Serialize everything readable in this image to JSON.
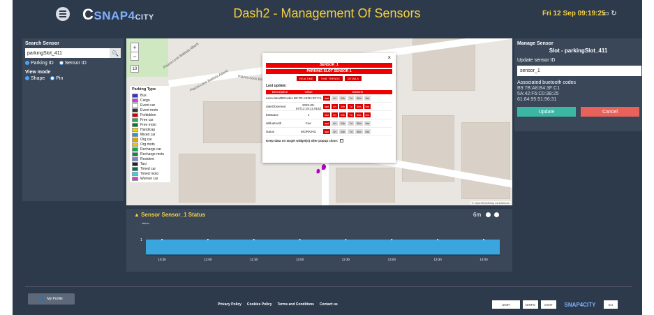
{
  "header": {
    "title": "Dash2 - Management Of Sensors",
    "datetime": "Fri 12 Sep 09:19:25",
    "logo": {
      "part1": "SNAP",
      "part2": "4",
      "part3": "CITY"
    }
  },
  "search_panel": {
    "title": "Search Sensor",
    "search_value": "parkingSlot_411",
    "options": [
      "Parking ID",
      "Sensor ID"
    ],
    "view_mode_label": "View mode",
    "view_options": [
      "Shape",
      "Pin"
    ]
  },
  "map": {
    "zoom_in": "+",
    "zoom_out": "−",
    "zoom_level": "19",
    "labels": [
      "Piazza Leon Battista Alberti",
      "Piazza Leon Battista Alberti",
      "Piazza Leon Ba"
    ],
    "attribution": "© OpenStreetMap contributors",
    "legend": {
      "title": "Parking Type",
      "items": [
        {
          "label": "Bus",
          "color": "#3a2ed6"
        },
        {
          "label": "Cargo",
          "color": "#d43ad6"
        },
        {
          "label": "Event car",
          "color": "#ffffff"
        },
        {
          "label": "Event moto",
          "color": "#333333"
        },
        {
          "label": "Forbidden",
          "color": "#cc0000"
        },
        {
          "label": "Free car",
          "color": "#1fb24a"
        },
        {
          "label": "Free moto",
          "color": "#0a7a2a"
        },
        {
          "label": "Handicap",
          "color": "#f2d200"
        },
        {
          "label": "Mixed car",
          "color": "#1f9ad6"
        },
        {
          "label": "Org car",
          "color": "#e0a800"
        },
        {
          "label": "Org moto",
          "color": "#f2c200"
        },
        {
          "label": "Recharge car",
          "color": "#13a84a"
        },
        {
          "label": "Recharge moto",
          "color": "#0d8a3a"
        },
        {
          "label": "Resident",
          "color": "#7f7fd6"
        },
        {
          "label": "Taxi",
          "color": "#222222"
        },
        {
          "label": "Timed car",
          "color": "#0d6b5c"
        },
        {
          "label": "Timed moto",
          "color": "#35d6e0"
        },
        {
          "label": "Women car",
          "color": "#d63ad6"
        }
      ]
    }
  },
  "popup": {
    "close": "×",
    "title1": "SENSOR_1",
    "title2": "PARKING SLOT SENSOR 1",
    "buttons": [
      "REALTIME",
      "TIME TRENDS",
      "DETAILS"
    ],
    "last_update": "Last update:",
    "columns": [
      "Description",
      "Value",
      "Buttons"
    ],
    "rows": [
      {
        "name": "associatedBtCodes",
        "value": "B9:7B:A8:B4:3F:C1,...",
        "buttons": [
          "last",
          "4h",
          "24h",
          "7d",
          "30d",
          "6m"
        ]
      },
      {
        "name": "dateObserved",
        "value": "2025-09-04T12:15:11.916Z",
        "buttons": [
          "last",
          "4h",
          "24h",
          "7d",
          "30d",
          "6m"
        ]
      },
      {
        "name": "bttStatus",
        "value": "1",
        "buttons": [
          "last",
          "4h",
          "24h",
          "7d",
          "30d",
          "6m"
        ]
      },
      {
        "name": "isBluetooth",
        "value": "true",
        "buttons": [
          "last",
          "4h",
          "24h",
          "7d",
          "30d",
          "6m"
        ]
      },
      {
        "name": "status",
        "value": "WORKING",
        "buttons": [
          "last",
          "4h",
          "24h",
          "7d",
          "30d",
          "6m"
        ]
      }
    ],
    "keep_label": "Keep data on target widget(s) after popup close:"
  },
  "manage": {
    "title": "Manage Sensor",
    "slot": "Slot - parkingSlot_411",
    "update_label": "Update sensor ID",
    "sensor_value": "sensor_1",
    "codes_label": "Associated buetooth codes",
    "codes": [
      "B9:7B:A8:B4:3F:C1",
      "5A:42:F6:C0:3B:25",
      "61:84:95:51:96:31"
    ],
    "update_btn": "Update",
    "cancel_btn": "Cancel"
  },
  "status_widget": {
    "title": "Sensor Sensor_1 Status",
    "range": "6m",
    "ylabel": "status",
    "chart_data": {
      "type": "area",
      "x": [
        "10:30",
        "11:00",
        "11:30",
        "12:00",
        "12:30",
        "13:00",
        "13:30",
        "14:00"
      ],
      "values": [
        1,
        1,
        1,
        1,
        1,
        1,
        1,
        1
      ],
      "ylim": [
        0,
        1
      ],
      "yticks": [
        "1"
      ]
    }
  },
  "footer": {
    "profile_label": "My Profile",
    "links": [
      "Privacy Policy",
      "Cookies Policy",
      "Terms and Conditions",
      "Contact us"
    ],
    "partners": [
      "UNIFI",
      "DINFO",
      "DISIT",
      "SNAP4CITY",
      "EU"
    ]
  },
  "colors": {
    "accent": "#f5d142",
    "panel": "#3a4759",
    "bg": "#2d3a4b"
  }
}
